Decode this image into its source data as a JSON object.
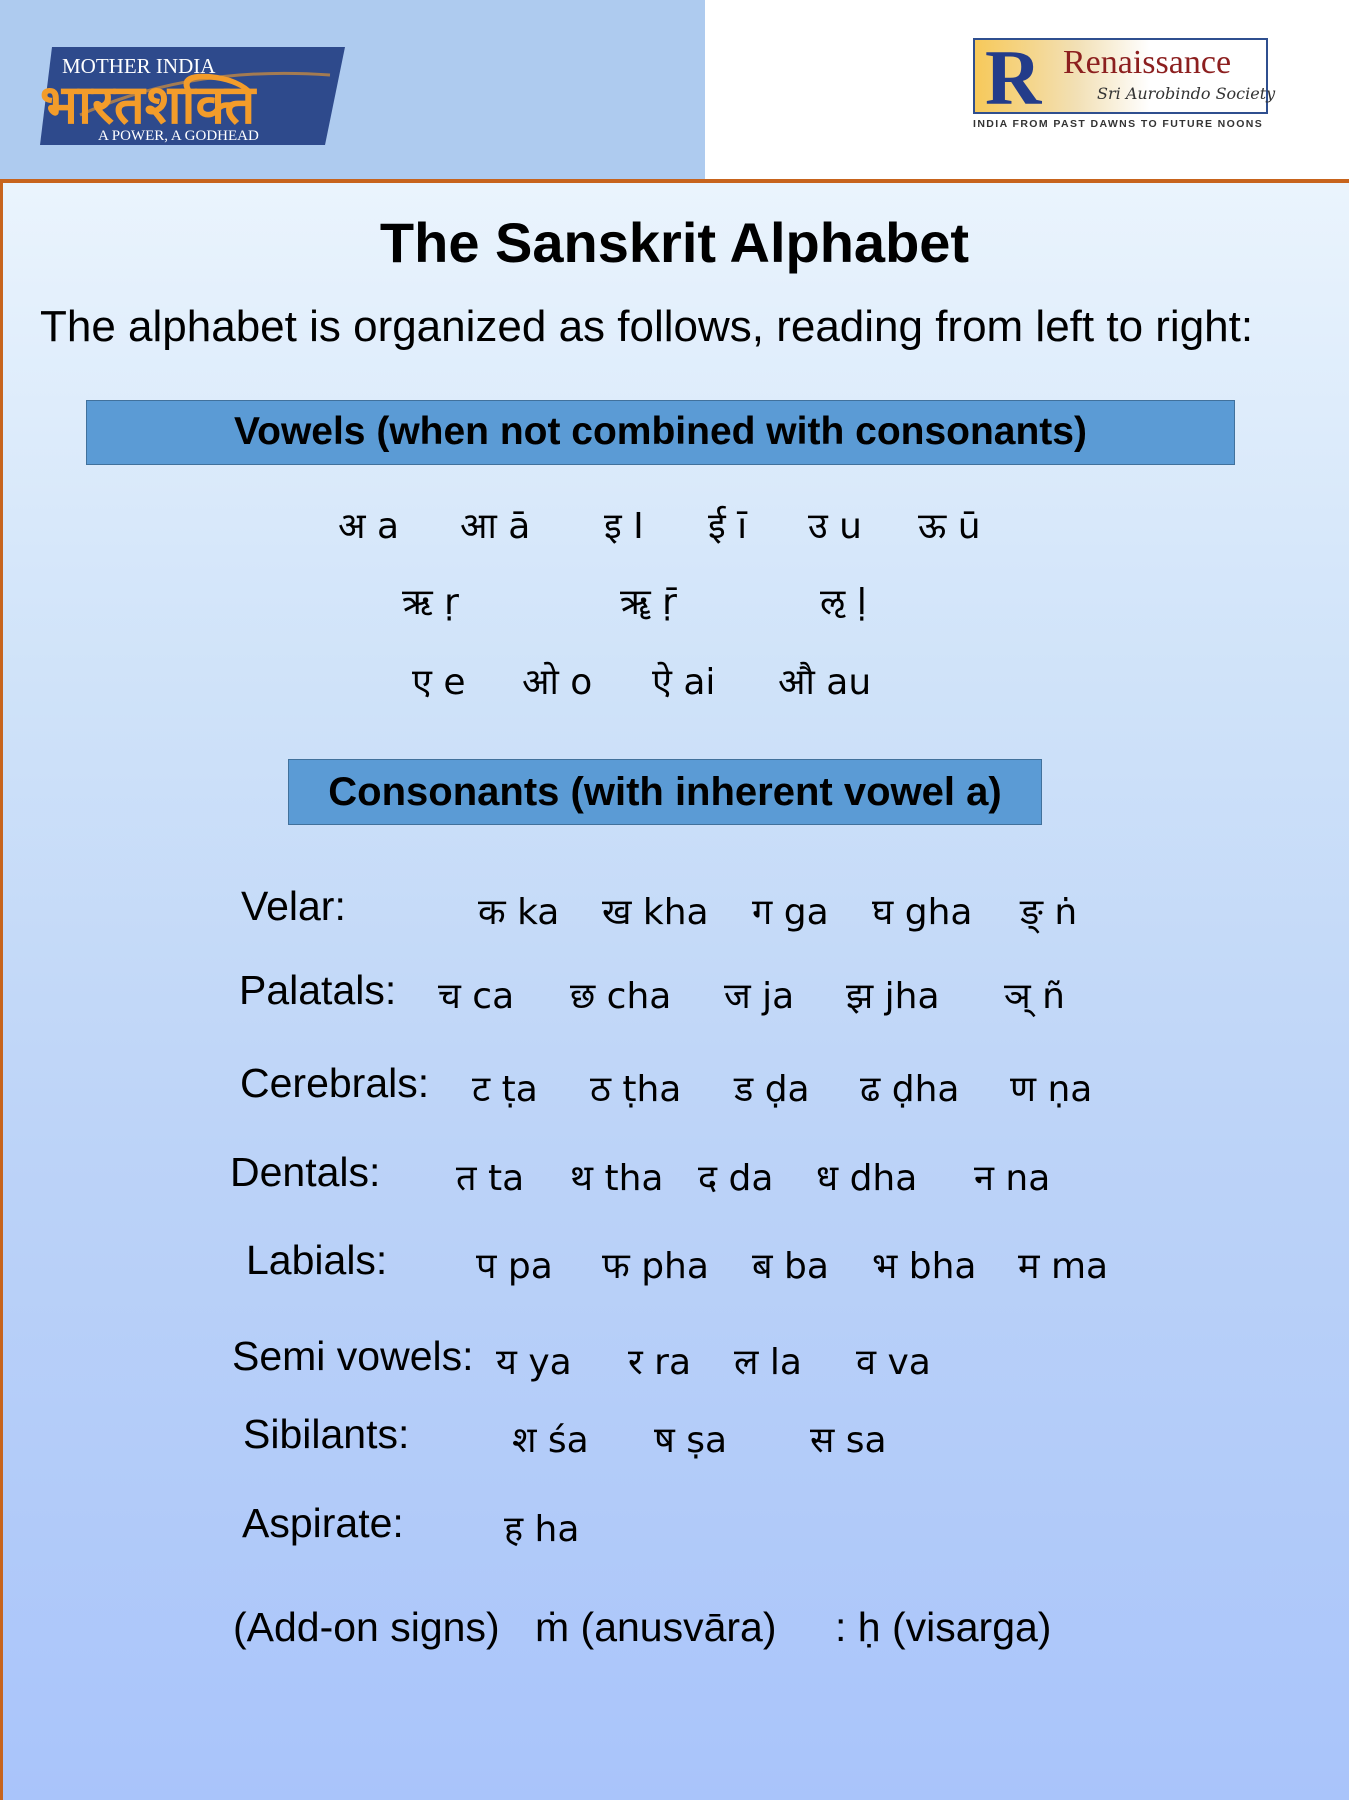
{
  "header": {
    "logo_left": {
      "top_text": "MOTHER INDIA",
      "devanagari": "भारतशक्ति",
      "bottom_text": "A POWER, A GODHEAD",
      "colors": {
        "bg": "#2e4a8c",
        "main": "#f39c2a"
      }
    },
    "logo_right": {
      "letter": "R",
      "name": "Renaissance",
      "sub": "Sri Aurobindo Society",
      "tagline": "INDIA FROM PAST DAWNS TO FUTURE NOONS"
    }
  },
  "title": "The Sanskrit Alphabet",
  "intro": "The alphabet is organized as follows, reading from left to right:",
  "vowels": {
    "heading": "Vowels (when not combined with consonants)",
    "row1": [
      "अ a",
      "आ ā",
      "इ I",
      "ई ī",
      "उ u",
      "ऊ ū"
    ],
    "row2": [
      "ऋ ṛ",
      "ॠ ṝ",
      "ऌ ḷ"
    ],
    "row3": [
      "ए e",
      "ओ o",
      "ऐ ai",
      "औ au"
    ]
  },
  "consonants": {
    "heading": "Consonants (with inherent vowel a)",
    "rows": [
      {
        "label": "Velar:",
        "items": [
          "क ka",
          "ख kha",
          "ग ga",
          "घ gha",
          "ङ् ṅ"
        ]
      },
      {
        "label": "Palatals:",
        "items": [
          "च ca",
          "छ cha",
          "ज ja",
          "झ jha",
          "ञ् ñ"
        ]
      },
      {
        "label": "Cerebrals:",
        "items": [
          "ट ṭa",
          "ठ ṭha",
          "ड ḍa",
          "ढ ḍha",
          "ण ṇa"
        ]
      },
      {
        "label": "Dentals:",
        "items": [
          "त ta",
          "थ tha",
          "द da",
          "ध dha",
          "न na"
        ]
      },
      {
        "label": "Labials:",
        "items": [
          "प pa",
          "फ pha",
          "ब ba",
          "भ bha",
          "म ma"
        ]
      },
      {
        "label": "Semi vowels:",
        "items": [
          "य ya",
          "र ra",
          "ल la",
          "व va"
        ]
      },
      {
        "label": "Sibilants:",
        "items": [
          "श śa",
          "ष ṣa",
          "स sa"
        ]
      },
      {
        "label": "Aspirate:",
        "items": [
          "ह ha"
        ]
      }
    ],
    "addon": {
      "label": "(Add-on signs)",
      "anusvara": "ṁ (anusvāra)",
      "visarga": ": ḥ (visarga)"
    }
  }
}
